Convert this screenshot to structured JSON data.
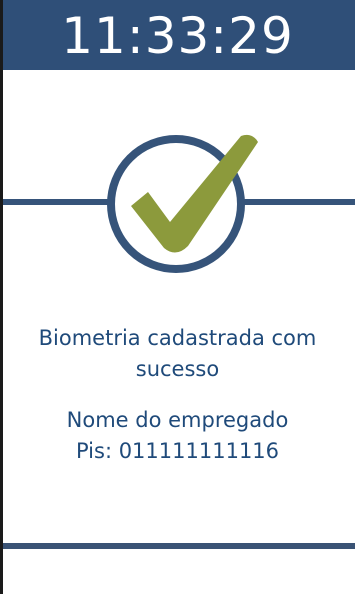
{
  "clock": {
    "time": "11:33:29"
  },
  "status": {
    "icon": "checkmark-icon",
    "message_line1": "Biometria cadastrada com",
    "message_line2": "sucesso"
  },
  "employee": {
    "name": "Nome do empregado",
    "pis": "Pis: 011111111116"
  },
  "colors": {
    "header_bg": "#2f4f78",
    "text": "#1f4a7a",
    "ring": "#36547a",
    "check": "#8c9a3c",
    "rule": "#3a5375"
  }
}
